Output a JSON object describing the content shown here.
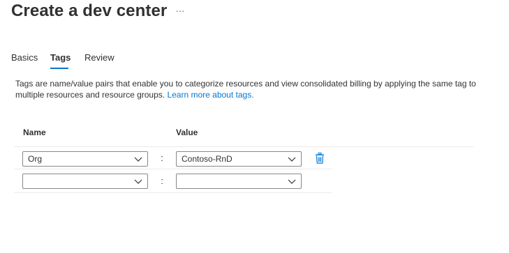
{
  "header": {
    "title": "Create a dev center",
    "more_label": "···"
  },
  "tabs": [
    {
      "label": "Basics",
      "active": false
    },
    {
      "label": "Tags",
      "active": true
    },
    {
      "label": "Review",
      "active": false
    }
  ],
  "description": {
    "text": "Tags are name/value pairs that enable you to categorize resources and view consolidated billing by applying the same tag to multiple resources and resource groups.",
    "link_text": "Learn more about tags."
  },
  "table": {
    "headers": {
      "name": "Name",
      "value": "Value"
    },
    "separator": ":",
    "rows": [
      {
        "name": "Org",
        "value": "Contoso-RnD",
        "deletable": true
      },
      {
        "name": "",
        "value": "",
        "deletable": false
      }
    ]
  },
  "colors": {
    "accent": "#0078d4",
    "text": "#323130",
    "border": "#8a8886",
    "divider": "#edebe9"
  },
  "icons": {
    "more": "more-horizontal-icon",
    "dropdown": "chevron-down-icon",
    "delete": "trash-icon"
  }
}
